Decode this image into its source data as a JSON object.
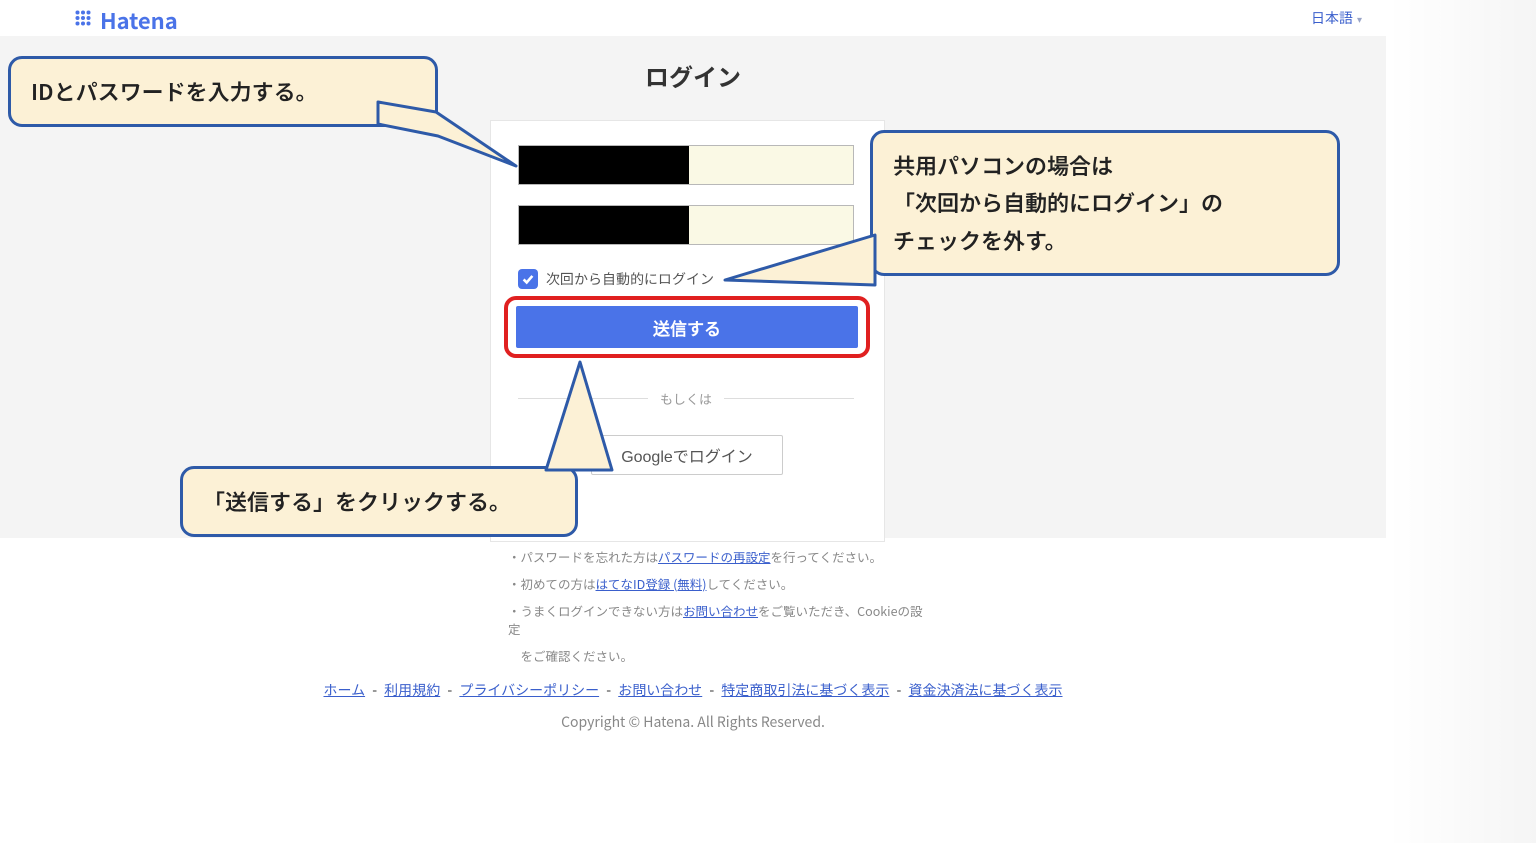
{
  "header": {
    "brand": "Hatena",
    "language": "日本語"
  },
  "page": {
    "title": "ログイン"
  },
  "form": {
    "auto_login_label": "次回から自動的にログイン",
    "submit_label": "送信する",
    "or_label": "もしくは",
    "google_label": "Googleでログイン"
  },
  "help": {
    "line1_pre": "・パスワードを忘れた方は",
    "line1_link": "パスワードの再設定",
    "line1_post": "を行ってください。",
    "line2_pre": "・初めての方は",
    "line2_link": "はてなID登録 (無料)",
    "line2_post": "してください。",
    "line3_pre": "・うまくログインできない方は",
    "line3_link": "お問い合わせ",
    "line3_post": "をご覧いただき、Cookieの設定",
    "line3_post2": "　をご確認ください。"
  },
  "footer": {
    "links": [
      "ホーム",
      "利用規約",
      "プライバシーポリシー",
      "お問い合わせ",
      "特定商取引法に基づく表示",
      "資金決済法に基づく表示"
    ],
    "sep": " - ",
    "copyright": "Copyright © Hatena. All Rights Reserved."
  },
  "callouts": {
    "c1": "IDとパスワードを入力する。",
    "c2_l1": "共用パソコンの場合は",
    "c2_l2": "「次回から自動的にログイン」の",
    "c2_l3": "チェックを外す。",
    "c3": "「送信する」をクリックする。"
  }
}
